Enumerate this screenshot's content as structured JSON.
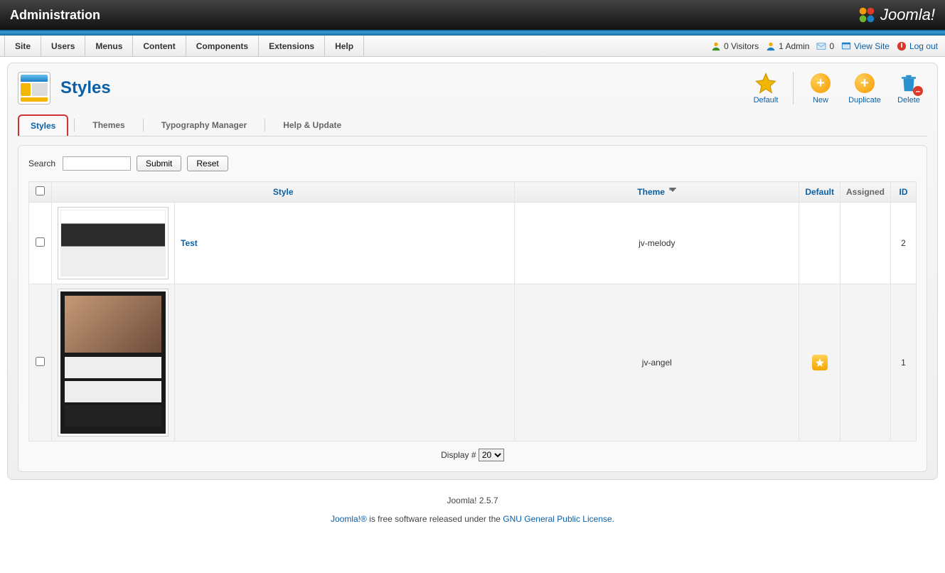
{
  "header": {
    "title": "Administration",
    "brand": "Joomla!"
  },
  "menu": {
    "items": [
      "Site",
      "Users",
      "Menus",
      "Content",
      "Components",
      "Extensions",
      "Help"
    ]
  },
  "status": {
    "visitors": "0 Visitors",
    "admin": "1 Admin",
    "messages": "0",
    "view_site": "View Site",
    "logout": "Log out"
  },
  "page": {
    "title": "Styles"
  },
  "toolbar": {
    "default": "Default",
    "new": "New",
    "duplicate": "Duplicate",
    "delete": "Delete"
  },
  "tabs": {
    "styles": "Styles",
    "themes": "Themes",
    "typography": "Typography Manager",
    "help": "Help & Update"
  },
  "filter": {
    "search_label": "Search",
    "submit": "Submit",
    "reset": "Reset"
  },
  "columns": {
    "style": "Style",
    "theme": "Theme",
    "default": "Default",
    "assigned": "Assigned",
    "id": "ID"
  },
  "rows": [
    {
      "style": "Test",
      "theme": "jv-melody",
      "default": false,
      "id": "2"
    },
    {
      "style": "",
      "theme": "jv-angel",
      "default": true,
      "id": "1"
    }
  ],
  "pagination": {
    "display_label": "Display #",
    "value": "20"
  },
  "footer": {
    "version": "Joomla! 2.5.7",
    "line_prefix": "Joomla!®",
    "line_mid": " is free software released under the ",
    "gpl": "GNU General Public License."
  }
}
